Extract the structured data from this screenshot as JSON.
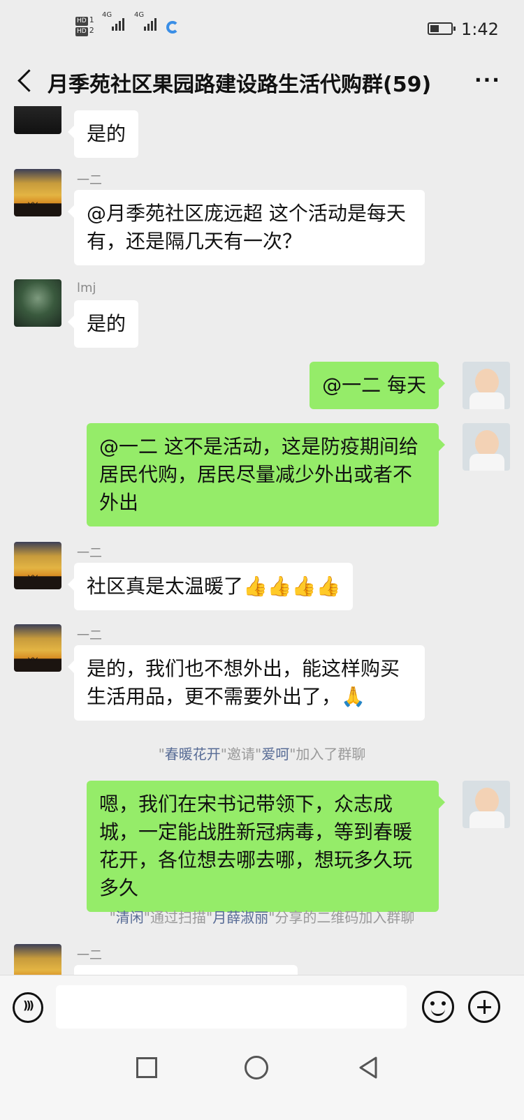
{
  "status_bar": {
    "sim1": "HD",
    "sim1_num": "1",
    "sim2": "HD",
    "sim2_num": "2",
    "net1": "4G",
    "net2": "4G",
    "time": "1:42"
  },
  "header": {
    "title": "月季苑社区果园路建设路生活代购群(59)",
    "more": "···"
  },
  "messages": [
    {
      "side": "left",
      "sender": "",
      "text": "是的"
    },
    {
      "side": "left",
      "sender": "一二",
      "text": "@月季苑社区庞远超  这个活动是每天有，还是隔几天有一次？"
    },
    {
      "side": "left",
      "sender": "lmj",
      "text": "是的"
    },
    {
      "side": "right",
      "text": "@一二  每天"
    },
    {
      "side": "right",
      "text": "@一二  这不是活动，这是防疫期间给居民代购，居民尽量减少外出或者不外出"
    },
    {
      "side": "left",
      "sender": "一二",
      "text": "社区真是太温暖了",
      "emoji": "👍👍👍👍"
    },
    {
      "side": "left",
      "sender": "一二",
      "text": "是的，我们也不想外出，能这样购买生活用品，更不需要外出了，",
      "emoji": "🙏"
    },
    {
      "side": "right",
      "text": "嗯，我们在宋书记带领下，众志成城，一定能战胜新冠病毒，等到春暖花开，各位想去哪去哪，想玩多久玩多久"
    },
    {
      "side": "left",
      "sender": "一二",
      "text": ""
    }
  ],
  "system_messages": [
    {
      "q1": "\"",
      "name1": "春暖花开",
      "mid": "\"邀请\"",
      "name2": "爱呵",
      "end": "\"加入了群聊"
    },
    {
      "q1": "\"",
      "name1": "清闲",
      "mid": "\"通过扫描\"",
      "name2": "月薛淑丽",
      "end": "\"分享的二维码加入群聊"
    }
  ],
  "icons": {
    "voice": "voice-icon",
    "emoji": "emoji-icon",
    "plus": "plus-icon",
    "back": "back-icon"
  }
}
